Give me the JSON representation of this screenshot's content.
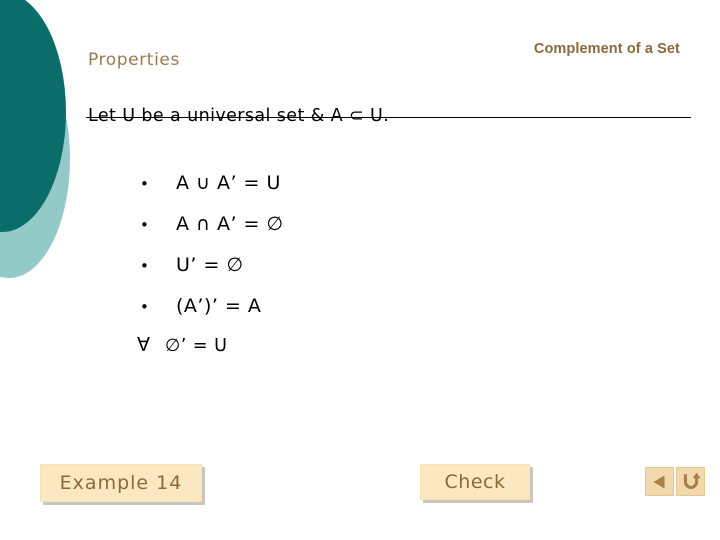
{
  "slide": {
    "header_title": "Complement of a Set",
    "title": "Properties",
    "lead_line": "Let U be a universal set & A ⊂ U."
  },
  "properties": [
    {
      "marker": "•",
      "text": "A ∪ A’ = U"
    },
    {
      "marker": "•",
      "text": "A ∩ A’ = ∅"
    },
    {
      "marker": "•",
      "text": "U’ = ∅"
    },
    {
      "marker": "•",
      "text": "(A’)’ = A"
    },
    {
      "marker": "∀",
      "text": "∅’ = U"
    }
  ],
  "buttons": {
    "example_label": "Example 14",
    "check_label": "Check"
  },
  "navigation": {
    "back_icon": "triangle-left-icon",
    "return_icon": "u-turn-arrow-icon"
  },
  "colors": {
    "circle_dark": "#0a6d6a",
    "circle_light": "#93c9c6",
    "header_text": "#8a6a3c",
    "title_text": "#9b7a52",
    "button_fill": "#fbe8c0",
    "nav_fill": "#f2d9ab",
    "body_text": "#000000"
  }
}
